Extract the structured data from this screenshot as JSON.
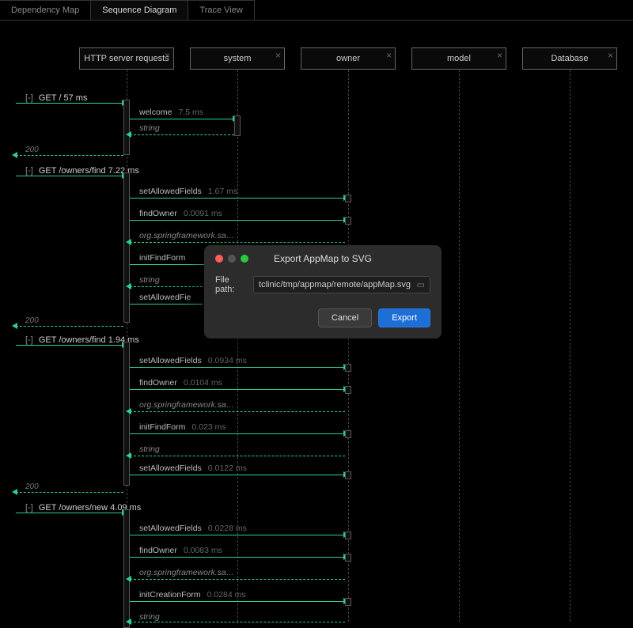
{
  "tabs": {
    "dep": "Dependency Map",
    "seq": "Sequence Diagram",
    "trace": "Trace View"
  },
  "cols": {
    "http": "HTTP server requests",
    "system": "system",
    "owner": "owner",
    "model": "model",
    "db": "Database"
  },
  "close_glyph": "×",
  "ext": {
    "get_root": {
      "toggle": "[-]",
      "label": "GET /",
      "dur": "57 ms"
    },
    "get_find1": {
      "toggle": "[-]",
      "label": "GET /owners/find",
      "dur": "7.22 ms"
    },
    "get_find2": {
      "toggle": "[-]",
      "label": "GET /owners/find",
      "dur": "1.94 ms"
    },
    "get_new": {
      "toggle": "[-]",
      "label": "GET /owners/new",
      "dur": "4.09 ms"
    }
  },
  "status200": "200",
  "msgs": {
    "welcome": {
      "label": "welcome",
      "dur": "7.5 ms"
    },
    "string": "string",
    "setAllowed1": {
      "label": "setAllowedFields",
      "dur": "1.67 ms"
    },
    "findOwner1": {
      "label": "findOwner",
      "dur": "0.0091 ms"
    },
    "spring": "org.springframework.sa…",
    "initFindForm1": {
      "label": "initFindForm"
    },
    "setAllowedFie": "setAllowedFie",
    "setAllowed2": {
      "label": "setAllowedFields",
      "dur": "0.0934 ms"
    },
    "findOwner2": {
      "label": "findOwner",
      "dur": "0.0104 ms"
    },
    "initFindForm2": {
      "label": "initFindForm",
      "dur": "0.023 ms"
    },
    "setAllowed2b": {
      "label": "setAllowedFields",
      "dur": "0.0122 ms"
    },
    "setAllowed3": {
      "label": "setAllowedFields",
      "dur": "0.0228 ms"
    },
    "findOwner3": {
      "label": "findOwner",
      "dur": "0.0083 ms"
    },
    "initCreation": {
      "label": "initCreationForm",
      "dur": "0.0284 ms"
    }
  },
  "dialog": {
    "title": "Export AppMap to SVG",
    "file_label": "File path:",
    "file_value": "tclinic/tmp/appmap/remote/appMap.svg",
    "cancel": "Cancel",
    "export": "Export"
  }
}
